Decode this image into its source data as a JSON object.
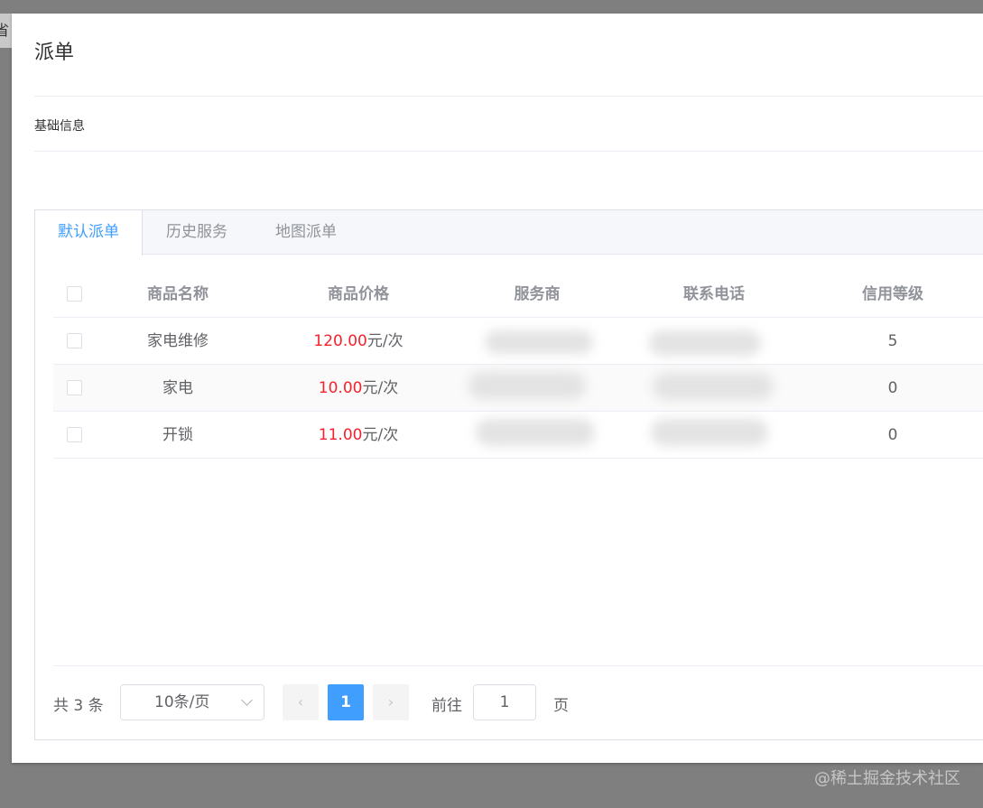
{
  "background": {
    "fragment_text": "省"
  },
  "dialog": {
    "title": "派单",
    "section_title": "基础信息"
  },
  "tabs": [
    {
      "label": "默认派单",
      "active": true
    },
    {
      "label": "历史服务",
      "active": false
    },
    {
      "label": "地图派单",
      "active": false
    }
  ],
  "table": {
    "columns": [
      "商品名称",
      "商品价格",
      "服务商",
      "联系电话",
      "信用等级"
    ],
    "rows": [
      {
        "name": "家电维修",
        "price": "120.00",
        "unit": "元/次",
        "provider": "",
        "phone": "",
        "credit": "5"
      },
      {
        "name": "家电",
        "price": "10.00",
        "unit": "元/次",
        "provider": "",
        "phone": "",
        "credit": "0"
      },
      {
        "name": "开锁",
        "price": "11.00",
        "unit": "元/次",
        "provider": "",
        "phone": "",
        "credit": "0"
      }
    ]
  },
  "pagination": {
    "total": "共 3 条",
    "page_size": "10条/页",
    "prev": "‹",
    "current_page": "1",
    "next": "›",
    "goto_label": "前往",
    "goto_value": "1",
    "goto_suffix": "页"
  },
  "watermark": "@稀土掘金技术社区",
  "colors": {
    "accent": "#409eff",
    "price": "#f5222d",
    "overlay": "#7f7f7f"
  }
}
